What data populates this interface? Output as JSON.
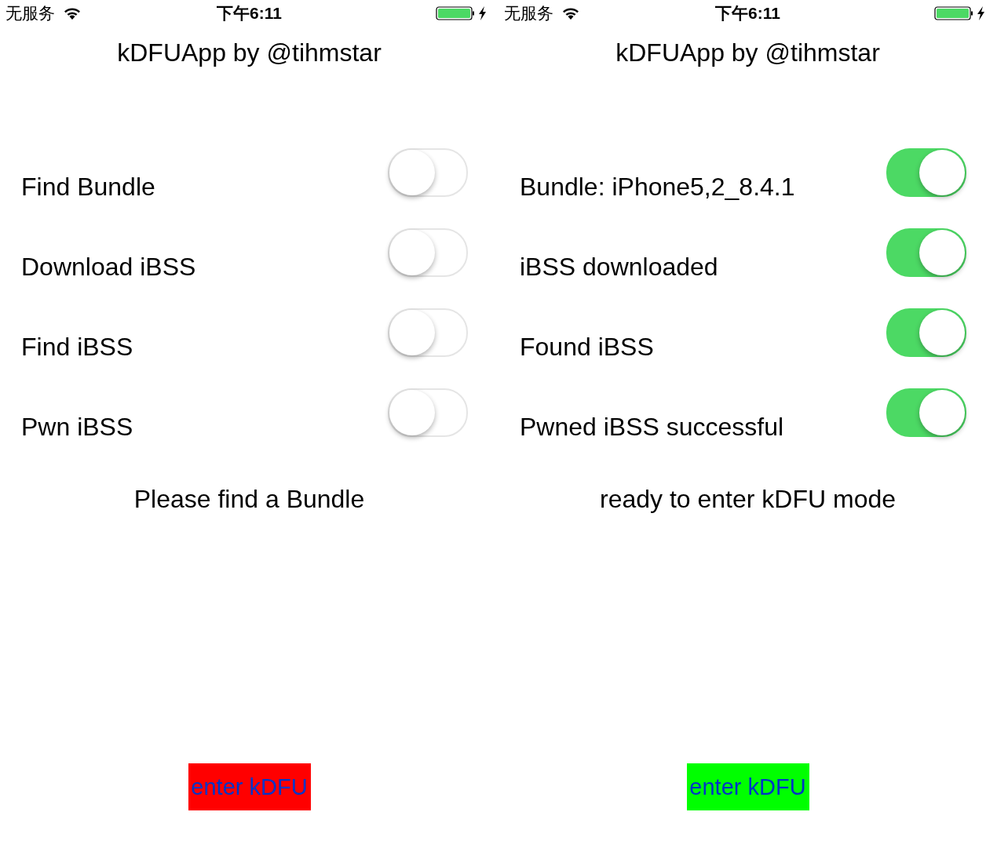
{
  "screens": [
    {
      "status_bar": {
        "carrier": "无服务",
        "time": "下午6:11"
      },
      "title": "kDFUApp by @tihmstar",
      "steps": [
        {
          "label": "Find Bundle",
          "on": false
        },
        {
          "label": "Download iBSS",
          "on": false
        },
        {
          "label": "Find iBSS",
          "on": false
        },
        {
          "label": "Pwn iBSS",
          "on": false
        }
      ],
      "message": "Please find a Bundle",
      "button": {
        "label": "enter kDFU",
        "color": "#ff0000"
      }
    },
    {
      "status_bar": {
        "carrier": "无服务",
        "time": "下午6:11"
      },
      "title": "kDFUApp by @tihmstar",
      "steps": [
        {
          "label": "Bundle: iPhone5,2_8.4.1",
          "on": true
        },
        {
          "label": "iBSS downloaded",
          "on": true
        },
        {
          "label": "Found iBSS",
          "on": true
        },
        {
          "label": "Pwned iBSS successful",
          "on": true
        }
      ],
      "message": "ready to enter kDFU mode",
      "button": {
        "label": "enter kDFU",
        "color": "#00ff00"
      }
    }
  ]
}
